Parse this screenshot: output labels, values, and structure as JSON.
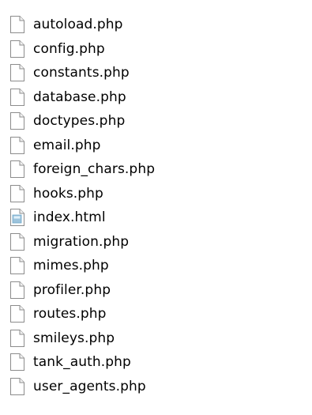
{
  "colors": {
    "background": "#ffffff",
    "text": "#000000",
    "icon_border": "#8c8c8c",
    "icon_fill": "#ffffff",
    "html_icon_accent": "#6fa8c9"
  },
  "files": [
    {
      "name": "autoload.php",
      "icon": "blank-document-icon"
    },
    {
      "name": "config.php",
      "icon": "blank-document-icon"
    },
    {
      "name": "constants.php",
      "icon": "blank-document-icon"
    },
    {
      "name": "database.php",
      "icon": "blank-document-icon"
    },
    {
      "name": "doctypes.php",
      "icon": "blank-document-icon"
    },
    {
      "name": "email.php",
      "icon": "blank-document-icon"
    },
    {
      "name": "foreign_chars.php",
      "icon": "blank-document-icon"
    },
    {
      "name": "hooks.php",
      "icon": "blank-document-icon"
    },
    {
      "name": "index.html",
      "icon": "html-document-icon"
    },
    {
      "name": "migration.php",
      "icon": "blank-document-icon"
    },
    {
      "name": "mimes.php",
      "icon": "blank-document-icon"
    },
    {
      "name": "profiler.php",
      "icon": "blank-document-icon"
    },
    {
      "name": "routes.php",
      "icon": "blank-document-icon"
    },
    {
      "name": "smileys.php",
      "icon": "blank-document-icon"
    },
    {
      "name": "tank_auth.php",
      "icon": "blank-document-icon"
    },
    {
      "name": "user_agents.php",
      "icon": "blank-document-icon"
    }
  ]
}
